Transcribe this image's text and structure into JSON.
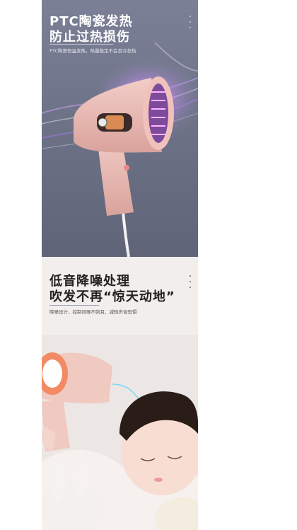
{
  "panel_ptc": {
    "title_line1": "PTC陶瓷发热",
    "title_line2": "防止过热损伤",
    "subtitle": "PTC陶瓷恒温发热，热量稳定不会忽冷忽热"
  },
  "panel_quiet": {
    "title_line1": "低音降噪处理",
    "title_line2": "吹发不再“惊天动地”",
    "subtitle": "降噪设计，控制风噪不刺耳，减轻声音恐惧"
  },
  "colors": {
    "ptc_bg": "#6e7388",
    "quiet_bg": "#f1eeec",
    "dryer_pink": "#e8b4ae",
    "glow_purple": "#c58cf5"
  },
  "icons": [
    "hair-dryer-illustration",
    "heating-element-icon",
    "mouse-scroll-icon"
  ]
}
